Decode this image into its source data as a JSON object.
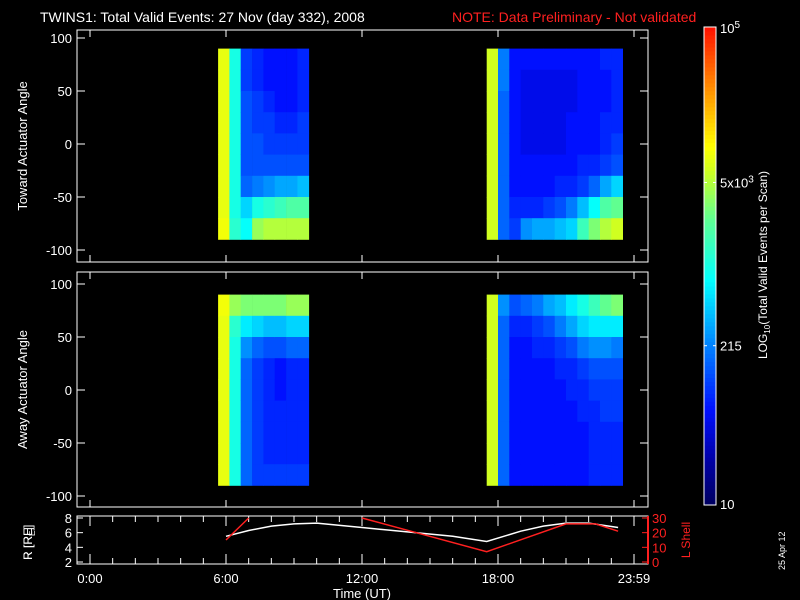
{
  "title": {
    "main": "TWINS1: Total Valid Events: 27 Nov (day 332), 2008",
    "note": "NOTE: Data Preliminary - Not validated"
  },
  "date_stamp": "25 Apr 12",
  "colors": {
    "background": "#000000",
    "text": "#ffffff",
    "note": "#ff2020",
    "lshell": "#ff2020",
    "radius": "#ffffff"
  },
  "chart_data": [
    {
      "type": "heatmap",
      "panel": "toward",
      "ylabel": "Toward Actuator Angle",
      "ylim": [
        -100,
        100
      ],
      "yticks": [
        "100",
        "50",
        "0",
        "-50",
        "-100"
      ],
      "ytick_values": [
        100,
        50,
        0,
        -50,
        -100
      ],
      "xlim_hours": [
        0,
        24
      ],
      "angle_bins": [
        80,
        60,
        40,
        20,
        0,
        -20,
        -40,
        -60,
        -80
      ],
      "time_bin_hours": 0.5,
      "blocks": [
        {
          "start_hour": 5.65,
          "columns_log10": [
            [
              3.9,
              3.9,
              3.9,
              3.9,
              3.9,
              3.9,
              3.9,
              3.9,
              3.95
            ],
            [
              3.0,
              3.0,
              3.0,
              3.0,
              3.0,
              3.0,
              3.0,
              3.0,
              3.1
            ],
            [
              2.0,
              2.0,
              2.1,
              2.1,
              2.1,
              2.1,
              2.2,
              2.7,
              2.9
            ],
            [
              1.9,
              1.9,
              2.0,
              2.0,
              2.1,
              2.1,
              2.3,
              3.0,
              3.6
            ],
            [
              1.8,
              1.8,
              1.9,
              2.0,
              2.0,
              2.1,
              2.4,
              3.1,
              3.7
            ],
            [
              1.8,
              1.8,
              1.8,
              1.9,
              2.0,
              2.1,
              2.5,
              3.2,
              3.7
            ],
            [
              1.8,
              1.8,
              1.8,
              1.9,
              2.0,
              2.1,
              2.5,
              3.3,
              3.7
            ],
            [
              1.9,
              1.9,
              1.9,
              2.0,
              2.0,
              2.1,
              2.6,
              3.3,
              3.7
            ]
          ]
        },
        {
          "start_hour": 17.5,
          "columns_log10": [
            [
              3.8,
              3.8,
              3.8,
              3.8,
              3.8,
              3.8,
              3.8,
              3.8,
              3.8
            ],
            [
              2.3,
              2.3,
              2.2,
              2.2,
              2.2,
              2.2,
              2.2,
              2.2,
              2.2
            ],
            [
              1.8,
              1.8,
              1.8,
              1.8,
              1.8,
              1.8,
              1.8,
              1.9,
              2.0
            ],
            [
              1.8,
              1.7,
              1.7,
              1.7,
              1.7,
              1.8,
              1.8,
              1.9,
              2.4
            ],
            [
              1.8,
              1.7,
              1.7,
              1.7,
              1.7,
              1.8,
              1.8,
              1.9,
              2.5
            ],
            [
              1.8,
              1.7,
              1.7,
              1.7,
              1.7,
              1.8,
              1.8,
              2.0,
              2.5
            ],
            [
              1.8,
              1.7,
              1.7,
              1.7,
              1.7,
              1.8,
              1.9,
              2.1,
              2.6
            ],
            [
              1.8,
              1.7,
              1.7,
              1.8,
              1.8,
              1.8,
              1.9,
              2.3,
              2.7
            ],
            [
              1.8,
              1.8,
              1.8,
              1.8,
              1.8,
              1.9,
              2.0,
              2.6,
              3.2
            ],
            [
              1.8,
              1.8,
              1.8,
              1.8,
              1.8,
              1.9,
              2.2,
              2.9,
              3.5
            ],
            [
              1.9,
              1.8,
              1.8,
              1.9,
              1.9,
              2.0,
              2.5,
              3.3,
              3.7
            ],
            [
              1.9,
              1.9,
              1.9,
              1.9,
              2.0,
              2.1,
              2.7,
              3.4,
              3.8
            ]
          ]
        }
      ]
    },
    {
      "type": "heatmap",
      "panel": "away",
      "ylabel": "Away Actuator Angle",
      "ylim": [
        -100,
        100
      ],
      "yticks": [
        "100",
        "50",
        "0",
        "-50",
        "-100"
      ],
      "ytick_values": [
        100,
        50,
        0,
        -50,
        -100
      ],
      "xlim_hours": [
        0,
        24
      ],
      "angle_bins": [
        80,
        60,
        40,
        20,
        0,
        -20,
        -40,
        -60,
        -80
      ],
      "time_bin_hours": 0.5,
      "blocks": [
        {
          "start_hour": 5.65,
          "columns_log10": [
            [
              3.95,
              3.9,
              3.9,
              3.9,
              3.9,
              3.9,
              3.9,
              3.9,
              3.9
            ],
            [
              3.6,
              3.1,
              3.0,
              3.0,
              3.0,
              3.0,
              3.0,
              3.0,
              3.0
            ],
            [
              3.5,
              2.8,
              2.4,
              2.2,
              2.2,
              2.2,
              2.2,
              2.2,
              2.2
            ],
            [
              3.5,
              2.7,
              2.2,
              2.0,
              2.0,
              2.0,
              2.0,
              2.0,
              2.0
            ],
            [
              3.5,
              2.6,
              2.1,
              1.9,
              1.9,
              1.9,
              1.9,
              1.9,
              2.0
            ],
            [
              3.5,
              2.6,
              2.1,
              1.8,
              1.8,
              1.9,
              1.9,
              1.9,
              2.0
            ],
            [
              3.6,
              2.7,
              2.2,
              1.9,
              1.9,
              1.9,
              1.9,
              1.9,
              2.0
            ],
            [
              3.6,
              2.7,
              2.2,
              1.9,
              1.9,
              1.9,
              1.9,
              1.9,
              2.0
            ]
          ]
        },
        {
          "start_hour": 17.5,
          "columns_log10": [
            [
              3.8,
              3.8,
              3.8,
              3.8,
              3.8,
              3.8,
              3.8,
              3.8,
              3.8
            ],
            [
              2.4,
              2.2,
              2.2,
              2.2,
              2.2,
              2.2,
              2.2,
              2.2,
              2.2
            ],
            [
              2.1,
              1.9,
              1.8,
              1.8,
              1.8,
              1.8,
              1.8,
              1.8,
              1.8
            ],
            [
              2.2,
              1.9,
              1.8,
              1.8,
              1.8,
              1.8,
              1.8,
              1.8,
              1.8
            ],
            [
              2.3,
              2.0,
              1.9,
              1.8,
              1.8,
              1.8,
              1.8,
              1.8,
              1.8
            ],
            [
              2.5,
              2.1,
              1.9,
              1.8,
              1.8,
              1.8,
              1.8,
              1.8,
              1.8
            ],
            [
              2.6,
              2.3,
              2.0,
              1.9,
              1.8,
              1.8,
              1.8,
              1.8,
              1.8
            ],
            [
              2.8,
              2.5,
              2.1,
              1.9,
              1.9,
              1.8,
              1.8,
              1.8,
              1.8
            ],
            [
              3.0,
              2.7,
              2.3,
              2.0,
              1.9,
              1.9,
              1.8,
              1.8,
              1.8
            ],
            [
              3.2,
              2.8,
              2.4,
              2.1,
              2.0,
              1.9,
              1.9,
              1.9,
              1.9
            ],
            [
              3.4,
              2.8,
              2.4,
              2.1,
              2.0,
              2.0,
              1.9,
              1.9,
              1.9
            ],
            [
              3.5,
              2.8,
              2.3,
              2.1,
              2.0,
              2.0,
              1.9,
              1.9,
              1.9
            ]
          ]
        }
      ]
    },
    {
      "type": "line",
      "panel": "orbit",
      "xlabel": "Time (UT)",
      "xticks": [
        "0:00",
        "6:00",
        "12:00",
        "18:00",
        "23:59"
      ],
      "xtick_hours": [
        0,
        6,
        12,
        18,
        24
      ],
      "ylabel_left": "R [RE]",
      "ylabel_left_main": "R [R",
      "ylabel_left_sub": "E",
      "ylabel_left_end": "]",
      "ylim_left": [
        2,
        8
      ],
      "yticks_left": [
        "8",
        "6",
        "4",
        "2"
      ],
      "ylabel_right": "L Shell",
      "ylim_right": [
        0,
        30
      ],
      "yticks_right": [
        "30",
        "20",
        "10",
        "0"
      ],
      "series": [
        {
          "name": "R",
          "axis": "left",
          "x": [
            6.0,
            7.0,
            8.0,
            9.0,
            10.0,
            12.0,
            14.0,
            16.0,
            17.5,
            19.0,
            20.0,
            21.0,
            22.0,
            23.3
          ],
          "y": [
            5.5,
            6.3,
            6.9,
            7.2,
            7.3,
            6.7,
            6.1,
            5.5,
            4.8,
            6.2,
            6.9,
            7.3,
            7.3,
            6.7
          ]
        },
        {
          "name": "L Shell",
          "axis": "right",
          "segments": [
            {
              "x": [
                6.0,
                7.0
              ],
              "y": [
                15,
                30
              ]
            },
            {
              "x": [
                12.0,
                17.5,
                21.0,
                22.3,
                23.3
              ],
              "y": [
                30,
                7,
                26,
                26,
                21
              ]
            }
          ]
        }
      ]
    },
    {
      "type": "colorbar",
      "label": "LOG10(Total Valid Events per Scan)",
      "label_main": "LOG",
      "label_sub": "10",
      "label_rest": "(Total Valid Events per Scan)",
      "log10_range": [
        1,
        5
      ],
      "ticks": [
        {
          "label": "10",
          "log10": 1
        },
        {
          "label": "215",
          "log10": 2.333
        },
        {
          "label": "5x10",
          "sup": "3",
          "log10": 3.699
        },
        {
          "label": "10",
          "sup": "5",
          "log10": 5
        }
      ]
    }
  ]
}
